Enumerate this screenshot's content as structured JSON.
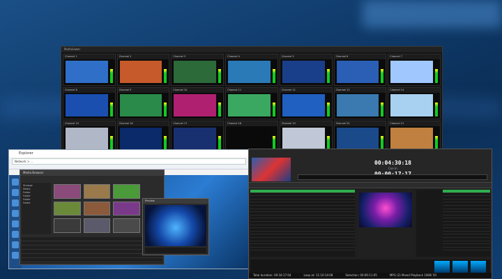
{
  "multiviewer": {
    "title": "Multiviewer",
    "tiles": [
      {
        "label": "Channel 1"
      },
      {
        "label": "Channel 2"
      },
      {
        "label": "Channel 3"
      },
      {
        "label": "Channel 4"
      },
      {
        "label": "Channel 5"
      },
      {
        "label": "Channel 6"
      },
      {
        "label": "Channel 7"
      },
      {
        "label": "Channel 8"
      },
      {
        "label": "Channel 9"
      },
      {
        "label": "Channel 10"
      },
      {
        "label": "Channel 11"
      },
      {
        "label": "Channel 12"
      },
      {
        "label": "Channel 13"
      },
      {
        "label": "Channel 14"
      },
      {
        "label": "Channel 15"
      },
      {
        "label": "Channel 16"
      },
      {
        "label": "Channel 17"
      },
      {
        "label": "Channel 18"
      },
      {
        "label": "Channel 19"
      },
      {
        "label": "Channel 20"
      },
      {
        "label": "Channel 21"
      }
    ],
    "tile_colors": [
      "#2f6fc8",
      "#c65a2a",
      "#2c6a3a",
      "#2a7ab8",
      "#1a3f8a",
      "#2a5fb5",
      "#a0c8ff",
      "#1a4fb0",
      "#2a8a4a",
      "#b02070",
      "#3aa860",
      "#2060c0",
      "#3a7ab0",
      "#a8d0f0",
      "#b0b8c8",
      "#0a2a6a",
      "#183070",
      "#0a0a0a",
      "#c0c8d8",
      "#1a4a8a",
      "#c08040"
    ]
  },
  "explorer": {
    "title": "Explorer",
    "address": "Network  >  ...",
    "sidebar_icons": 8
  },
  "browser": {
    "title": "Media Browser",
    "tree": [
      "Storage",
      "  Media",
      "    Folder",
      "    Folder",
      "    Folder",
      "    Folder"
    ],
    "info_rows": [
      "",
      "",
      "",
      "",
      "",
      ""
    ]
  },
  "preview": {
    "title": "Preview"
  },
  "playout": {
    "clock_top": "00:04:30:18",
    "clock_top_label": "Cue in",
    "clock_bottom": "00:00:17:17",
    "clock_bottom_label": "Duration",
    "playlist_header": "",
    "playlist_rows": 19,
    "right_rows": 19,
    "status": {
      "total": "Total duration: 00:18:17:04",
      "loop": "Loop at: 11:10:14:08",
      "selection": "Selection: 00:00:11:05",
      "format": "MPG (2) Mixed Playback 1080i 50"
    }
  }
}
